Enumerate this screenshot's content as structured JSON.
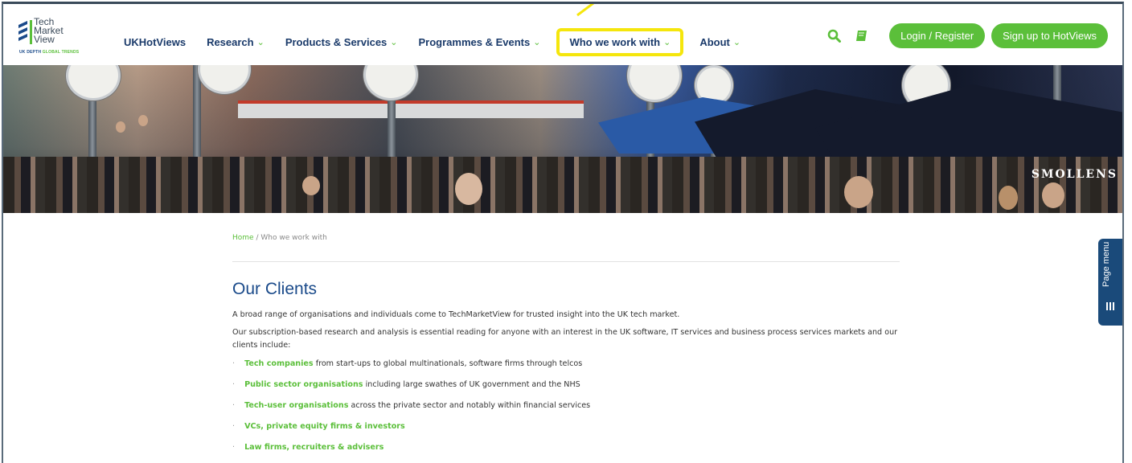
{
  "logo": {
    "line1": "Tech",
    "line2": "Market",
    "line3": "View",
    "tagline_a": "UK DEPTH",
    "tagline_b": "GLOBAL TRENDS"
  },
  "nav": {
    "items": [
      {
        "label": "UKHotViews",
        "chevron": false
      },
      {
        "label": "Research",
        "chevron": true
      },
      {
        "label": "Products & Services",
        "chevron": true
      },
      {
        "label": "Programmes & Events",
        "chevron": true
      },
      {
        "label": "Who we work with",
        "chevron": true,
        "highlighted": true
      },
      {
        "label": "About",
        "chevron": true
      }
    ],
    "chevron_glyph": "⌄"
  },
  "header_actions": {
    "login_label": "Login / Register",
    "signup_label": "Sign up to HotViews",
    "search_icon": "search-icon",
    "book_icon": "book-icon"
  },
  "hero": {
    "sign_text": "SMOLLENS"
  },
  "breadcrumb": {
    "home": "Home",
    "separator": "/",
    "current": "Who we work with"
  },
  "page": {
    "title": "Our Clients",
    "intro": "A broad range of organisations and individuals come to TechMarketView for trusted insight into the UK tech market.",
    "intro2": "Our subscription-based research and analysis is essential reading for anyone with an interest in the UK software, IT services and business process services markets and our clients include:",
    "clients": [
      {
        "highlight": "Tech companies",
        "rest": " from start-ups to global multinationals, software firms through telcos"
      },
      {
        "highlight": "Public sector organisations",
        "rest": " including large swathes of UK government and the NHS"
      },
      {
        "highlight": "Tech-user organisations",
        "rest": " across the private sector and notably within financial services"
      },
      {
        "highlight": "VCs, private equity firms & investors",
        "rest": ""
      },
      {
        "highlight": "Law firms, recruiters & advisers",
        "rest": ""
      }
    ],
    "bullet": "·"
  },
  "page_menu": {
    "label": "Page menu"
  },
  "colors": {
    "brand_green": "#5bbf3a",
    "brand_navy": "#1a4a8a",
    "highlight_yellow": "#f5e60c"
  }
}
